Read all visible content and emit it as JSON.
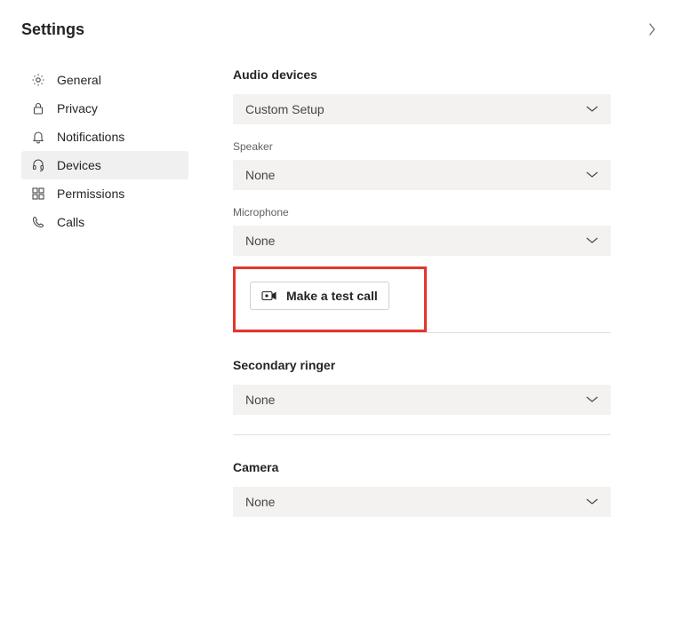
{
  "header": {
    "title": "Settings"
  },
  "sidebar": {
    "items": [
      {
        "label": "General"
      },
      {
        "label": "Privacy"
      },
      {
        "label": "Notifications"
      },
      {
        "label": "Devices"
      },
      {
        "label": "Permissions"
      },
      {
        "label": "Calls"
      }
    ]
  },
  "main": {
    "audio_devices": {
      "title": "Audio devices",
      "selected": "Custom Setup"
    },
    "speaker": {
      "label": "Speaker",
      "selected": "None"
    },
    "microphone": {
      "label": "Microphone",
      "selected": "None"
    },
    "test_call": {
      "label": "Make a test call"
    },
    "secondary_ringer": {
      "title": "Secondary ringer",
      "selected": "None"
    },
    "camera": {
      "title": "Camera",
      "selected": "None"
    }
  }
}
